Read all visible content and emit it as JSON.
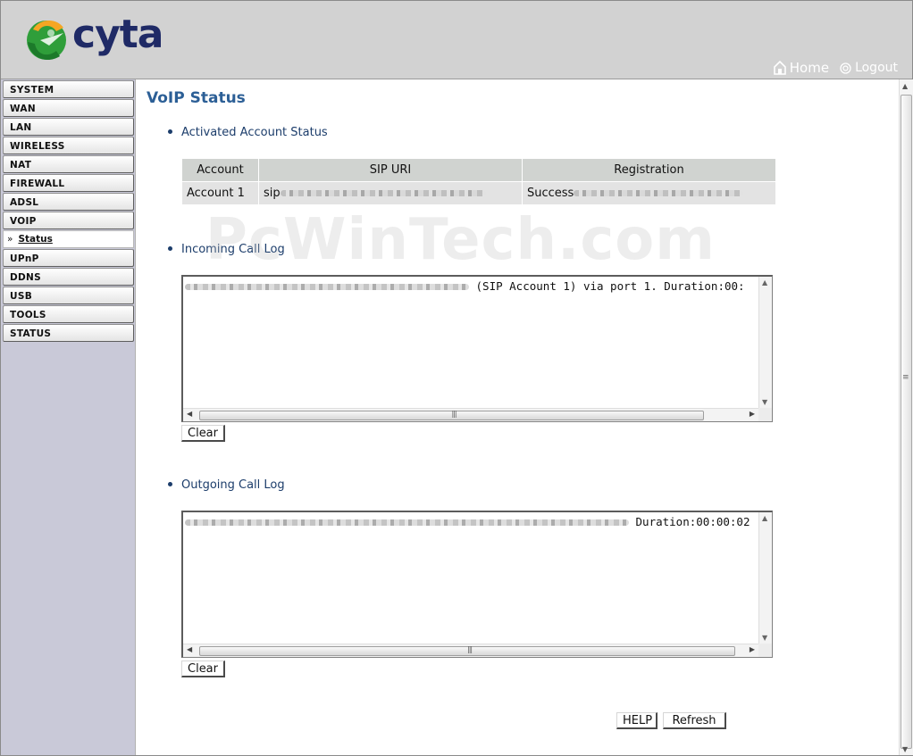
{
  "brand": {
    "name": "cyta"
  },
  "header": {
    "home_label": "Home",
    "logout_label": "Logout"
  },
  "sidebar": {
    "items": [
      {
        "label": "SYSTEM"
      },
      {
        "label": "WAN"
      },
      {
        "label": "LAN"
      },
      {
        "label": "WIRELESS"
      },
      {
        "label": "NAT"
      },
      {
        "label": "FIREWALL"
      },
      {
        "label": "ADSL"
      },
      {
        "label": "VOIP"
      },
      {
        "label": "UPnP"
      },
      {
        "label": "DDNS"
      },
      {
        "label": "USB"
      },
      {
        "label": "TOOLS"
      },
      {
        "label": "STATUS"
      }
    ],
    "sub_item": {
      "marker": "»",
      "label": "Status"
    }
  },
  "main": {
    "title": "VoIP Status",
    "account_section": {
      "heading": "Activated Account Status",
      "columns": [
        "Account",
        "SIP URI",
        "Registration"
      ],
      "rows": [
        {
          "account": "Account 1",
          "sip_uri": "sip",
          "registration": "Success"
        }
      ]
    },
    "incoming": {
      "heading": "Incoming Call Log",
      "log_text": "(SIP Account 1) via port 1. Duration:00:",
      "clear_label": "Clear"
    },
    "outgoing": {
      "heading": "Outgoing Call Log",
      "log_text": "Duration:00:00:02",
      "clear_label": "Clear"
    },
    "help_label": "HELP",
    "refresh_label": "Refresh"
  },
  "watermark": "PcWinTech.com",
  "colors": {
    "header_bg": "#d2d2d2",
    "sidebar_bg": "#c9c9d8",
    "title": "#2c5f96",
    "section_text": "#1c3d6b",
    "brand_text": "#1f2a66"
  }
}
